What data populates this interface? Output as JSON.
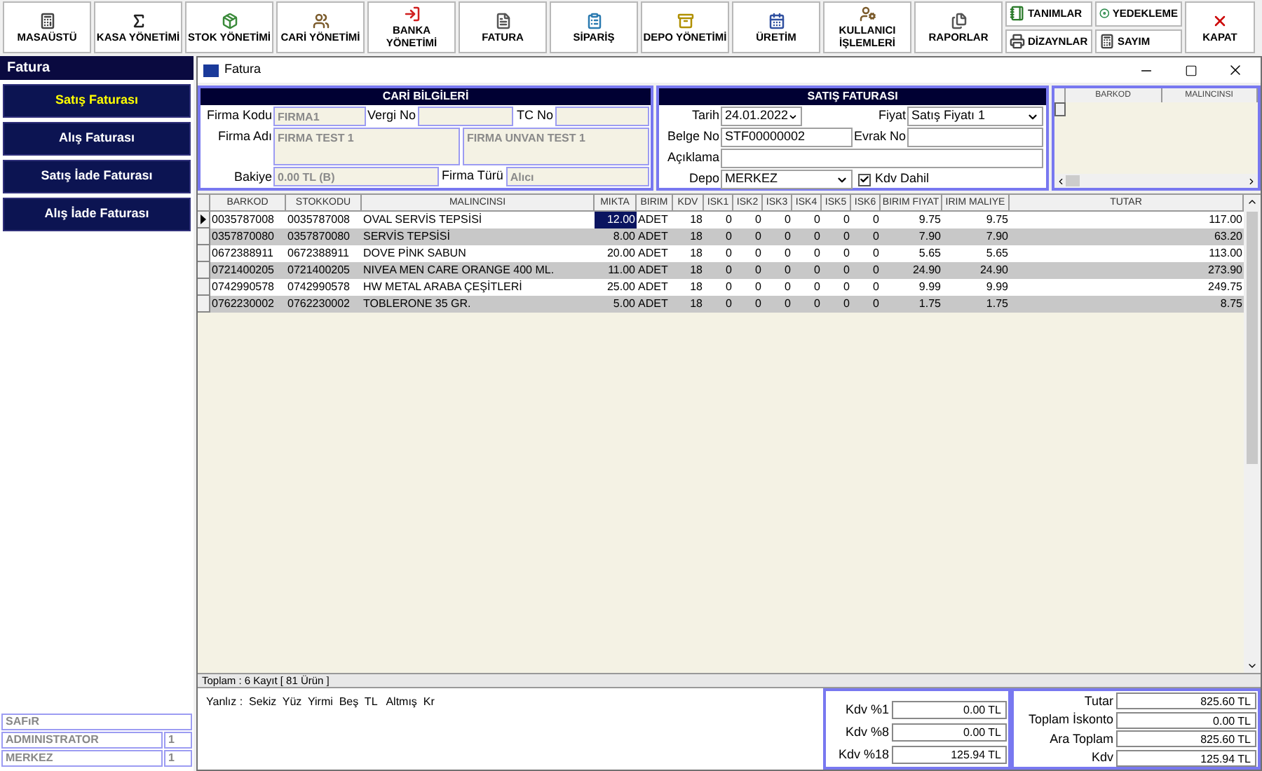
{
  "toolbar": [
    {
      "label": "MASAÜSTÜ",
      "kind": "large"
    },
    {
      "label": "KASA YÖNETİMİ",
      "kind": "large"
    },
    {
      "label": "STOK YÖNETİMİ",
      "kind": "large"
    },
    {
      "label": "CARİ YÖNETİMİ",
      "kind": "large"
    },
    {
      "label": "BANKA YÖNETİMİ",
      "kind": "large"
    },
    {
      "label": "FATURA",
      "kind": "large"
    },
    {
      "label": "SİPARİŞ",
      "kind": "large"
    },
    {
      "label": "DEPO YÖNETİMİ",
      "kind": "large"
    },
    {
      "label": "ÜRETİM",
      "kind": "large"
    },
    {
      "label": "KULLANICI İŞLEMLERİ",
      "kind": "large"
    },
    {
      "label": "RAPORLAR",
      "kind": "large"
    },
    {
      "label": "TANIMLAR",
      "kind": "small"
    },
    {
      "label": "DİZAYNLAR",
      "kind": "small"
    },
    {
      "label": "YEDEKLEME",
      "kind": "small"
    },
    {
      "label": "SAYIM",
      "kind": "small"
    },
    {
      "label": "KAPAT",
      "kind": "large"
    }
  ],
  "sidebar": {
    "title": "Fatura",
    "items": [
      {
        "label": "Satış Faturası",
        "selected": true
      },
      {
        "label": "Alış Faturası",
        "selected": false
      },
      {
        "label": "Satış İade Faturası",
        "selected": false
      },
      {
        "label": "Alış İade Faturası",
        "selected": false
      }
    ],
    "info": {
      "company": "SAFıR",
      "rows": [
        {
          "name": "ADMINISTRATOR",
          "value": "1"
        },
        {
          "name": "MERKEZ",
          "value": "1"
        }
      ]
    }
  },
  "window": {
    "title": "Fatura"
  },
  "cari": {
    "title": "CARİ BİLGİLERİ",
    "firma_kodu": {
      "label": "Firma Kodu",
      "value": "FIRMA1"
    },
    "vergi_no": {
      "label": "Vergi No"
    },
    "tc_no": {
      "label": "TC No"
    },
    "firma_adi": {
      "label": "Firma Adı",
      "value": "FIRMA TEST 1",
      "unvan": "FIRMA UNVAN TEST 1"
    },
    "bakiye": {
      "label": "Bakiye",
      "value": "0.00 TL (B)"
    },
    "firma_turu": {
      "label": "Firma Türü",
      "value": "Alıcı"
    }
  },
  "satis": {
    "title": "SATIŞ FATURASI",
    "tarih": {
      "label": "Tarih",
      "value": "24.01.2022"
    },
    "fiyat": {
      "label": "Fiyat",
      "value": "Satış Fiyatı 1"
    },
    "belge_no": {
      "label": "Belge No",
      "value": "STF00000002"
    },
    "evrak_no": {
      "label": "Evrak No"
    },
    "aciklama": {
      "label": "Açıklama"
    },
    "depo": {
      "label": "Depo",
      "value": "MERKEZ"
    },
    "kdv_dahil": {
      "label": "Kdv Dahil",
      "checked": true
    }
  },
  "mini_grid": {
    "columns": [
      "BARKOD",
      "MALINCINSI"
    ]
  },
  "table": {
    "columns": [
      "BARKOD",
      "STOKKODU",
      "MALINCINSI",
      "MIKTA",
      "BIRIM",
      "KDV",
      "ISK1",
      "ISK2",
      "ISK3",
      "ISK4",
      "ISK5",
      "ISK6",
      "BIRIM FIYAT",
      "IRIM MALIYE",
      "TUTAR"
    ],
    "rows": [
      {
        "selected": true,
        "cells": [
          "0035787008",
          "0035787008",
          "OVAL SERVİS TEPSİSİ",
          "12.00",
          "ADET",
          "18",
          "0",
          "0",
          "0",
          "0",
          "0",
          "0",
          "9.75",
          "9.75",
          "117.00"
        ]
      },
      {
        "selected": false,
        "cells": [
          "0357870080",
          "0357870080",
          "SERVİS TEPSİSİ",
          "8.00",
          "ADET",
          "18",
          "0",
          "0",
          "0",
          "0",
          "0",
          "0",
          "7.90",
          "7.90",
          "63.20"
        ]
      },
      {
        "selected": false,
        "cells": [
          "0672388911",
          "0672388911",
          "DOVE PİNK SABUN",
          "20.00",
          "ADET",
          "18",
          "0",
          "0",
          "0",
          "0",
          "0",
          "0",
          "5.65",
          "5.65",
          "113.00"
        ]
      },
      {
        "selected": false,
        "cells": [
          "0721400205",
          "0721400205",
          "NIVEA MEN CARE ORANGE 400 ML.",
          "11.00",
          "ADET",
          "18",
          "0",
          "0",
          "0",
          "0",
          "0",
          "0",
          "24.90",
          "24.90",
          "273.90"
        ]
      },
      {
        "selected": false,
        "cells": [
          "0742990578",
          "0742990578",
          "HW METAL ARABA ÇEŞİTLERİ",
          "25.00",
          "ADET",
          "18",
          "0",
          "0",
          "0",
          "0",
          "0",
          "0",
          "9.99",
          "9.99",
          "249.75"
        ]
      },
      {
        "selected": false,
        "cells": [
          "0762230002",
          "0762230002",
          "TOBLERONE 35 GR.",
          "5.00",
          "ADET",
          "18",
          "0",
          "0",
          "0",
          "0",
          "0",
          "0",
          "1.75",
          "1.75",
          "8.75"
        ]
      }
    ]
  },
  "status_bar": "Toplam : 6 Kayıt [ 81 Ürün ]",
  "yazi": "Yanlız :  Sekiz  Yüz  Yirmi  Beş  TL   Altmış  Kr",
  "kdv_totals": [
    {
      "label": "Kdv %1",
      "value": "0.00 TL"
    },
    {
      "label": "Kdv %8",
      "value": "0.00 TL"
    },
    {
      "label": "Kdv %18",
      "value": "125.94 TL"
    }
  ],
  "totals": [
    {
      "label": "Tutar",
      "value": "825.60 TL"
    },
    {
      "label": "Toplam İskonto",
      "value": "0.00 TL"
    },
    {
      "label": "Ara Toplam",
      "value": "825.60 TL"
    },
    {
      "label": "Kdv",
      "value": "125.94 TL"
    }
  ]
}
